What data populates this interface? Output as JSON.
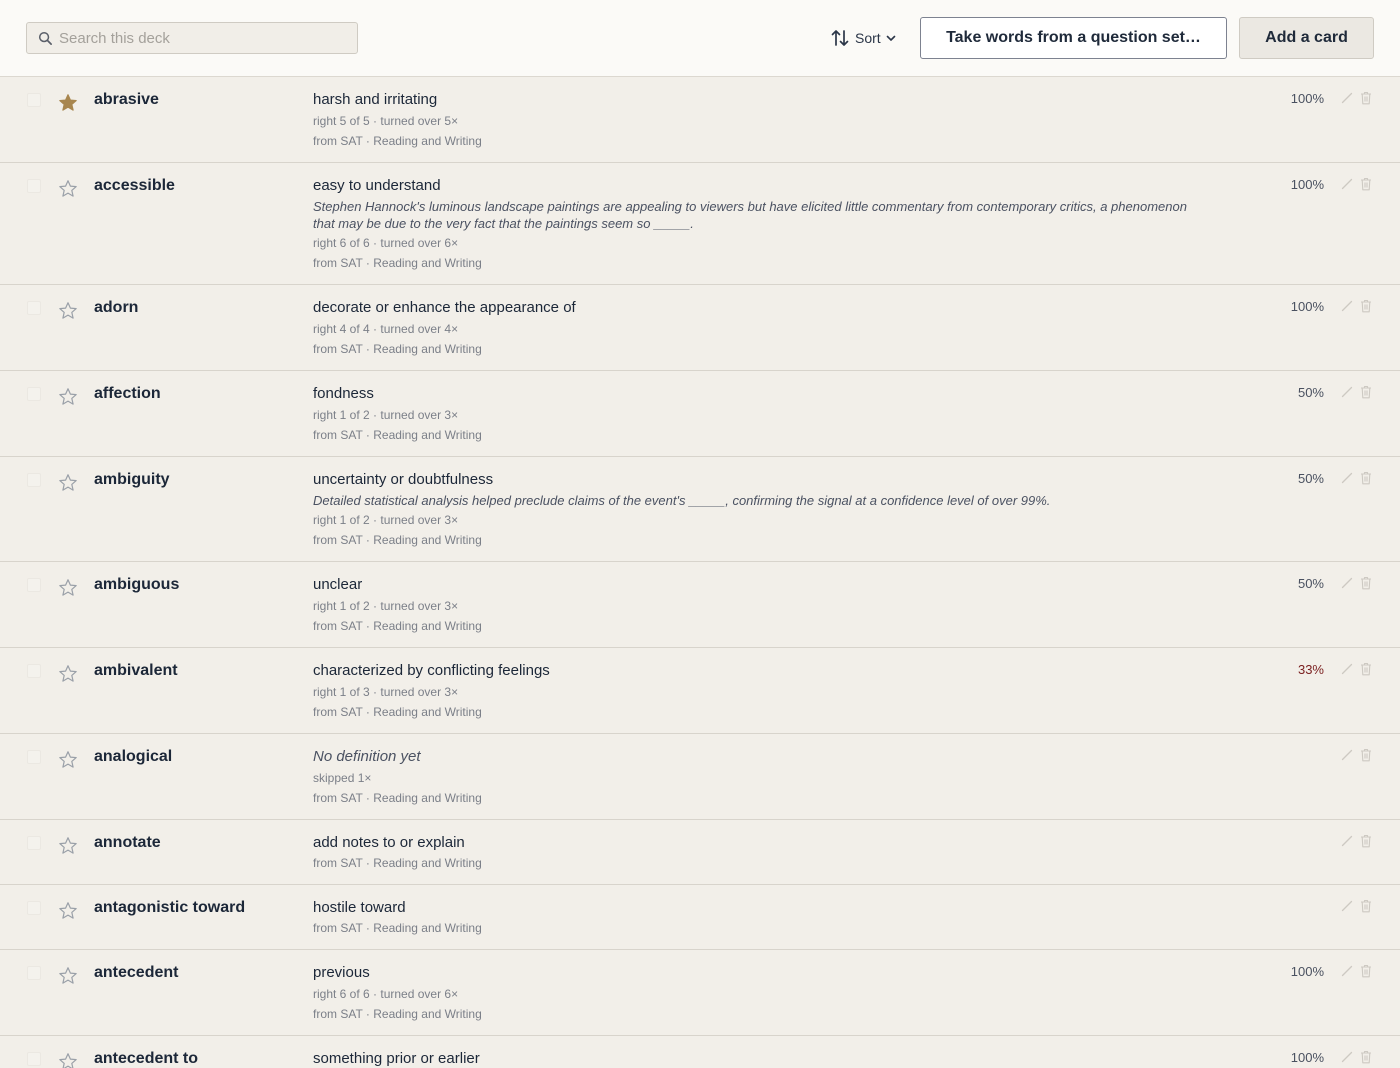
{
  "search": {
    "placeholder": "Search this deck",
    "value": ""
  },
  "toolbar": {
    "sort_label": "Sort",
    "take_words_label": "Take words from a question set…",
    "add_card_label": "Add a card"
  },
  "colors": {
    "star_filled": "#a8864f",
    "star_outline": "#9aa0a8",
    "low_score": "#7a1f1f"
  },
  "cards": [
    {
      "term": "abrasive",
      "starred": true,
      "definition": "harsh and irritating",
      "example": "",
      "stats": "right 5 of 5 · turned over 5×",
      "source": "from SAT · Reading and Writing",
      "score": "100%"
    },
    {
      "term": "accessible",
      "starred": false,
      "definition": "easy to understand",
      "example": "Stephen Hannock's luminous landscape paintings are appealing to viewers but have elicited little commentary from contemporary critics, a phenomenon that may be due to the very fact that the paintings seem so _____.",
      "stats": "right 6 of 6 · turned over 6×",
      "source": "from SAT · Reading and Writing",
      "score": "100%"
    },
    {
      "term": "adorn",
      "starred": false,
      "definition": "decorate or enhance the appearance of",
      "example": "",
      "stats": "right 4 of 4 · turned over 4×",
      "source": "from SAT · Reading and Writing",
      "score": "100%"
    },
    {
      "term": "affection",
      "starred": false,
      "definition": "fondness",
      "example": "",
      "stats": "right 1 of 2 · turned over 3×",
      "source": "from SAT · Reading and Writing",
      "score": "50%"
    },
    {
      "term": "ambiguity",
      "starred": false,
      "definition": "uncertainty or doubtfulness",
      "example": "Detailed statistical analysis helped preclude claims of the event's _____, confirming the signal at a confidence level of over 99%.",
      "stats": "right 1 of 2 · turned over 3×",
      "source": "from SAT · Reading and Writing",
      "score": "50%"
    },
    {
      "term": "ambiguous",
      "starred": false,
      "definition": "unclear",
      "example": "",
      "stats": "right 1 of 2 · turned over 3×",
      "source": "from SAT · Reading and Writing",
      "score": "50%"
    },
    {
      "term": "ambivalent",
      "starred": false,
      "definition": "characterized by conflicting feelings",
      "example": "",
      "stats": "right 1 of 3 · turned over 3×",
      "source": "from SAT · Reading and Writing",
      "score": "33%"
    },
    {
      "term": "analogical",
      "starred": false,
      "definition": "No definition yet",
      "example": "",
      "stats": "skipped 1×",
      "source": "from SAT · Reading and Writing",
      "score": ""
    },
    {
      "term": "annotate",
      "starred": false,
      "definition": "add notes to or explain",
      "example": "",
      "stats": "",
      "source": "from SAT · Reading and Writing",
      "score": ""
    },
    {
      "term": "antagonistic toward",
      "starred": false,
      "definition": "hostile toward",
      "example": "",
      "stats": "",
      "source": "from SAT · Reading and Writing",
      "score": ""
    },
    {
      "term": "antecedent",
      "starred": false,
      "definition": "previous",
      "example": "",
      "stats": "right 6 of 6 · turned over 6×",
      "source": "from SAT · Reading and Writing",
      "score": "100%"
    },
    {
      "term": "antecedent to",
      "starred": false,
      "definition": "something prior or earlier",
      "example": "",
      "stats": "",
      "source": "",
      "score": "100%"
    }
  ]
}
